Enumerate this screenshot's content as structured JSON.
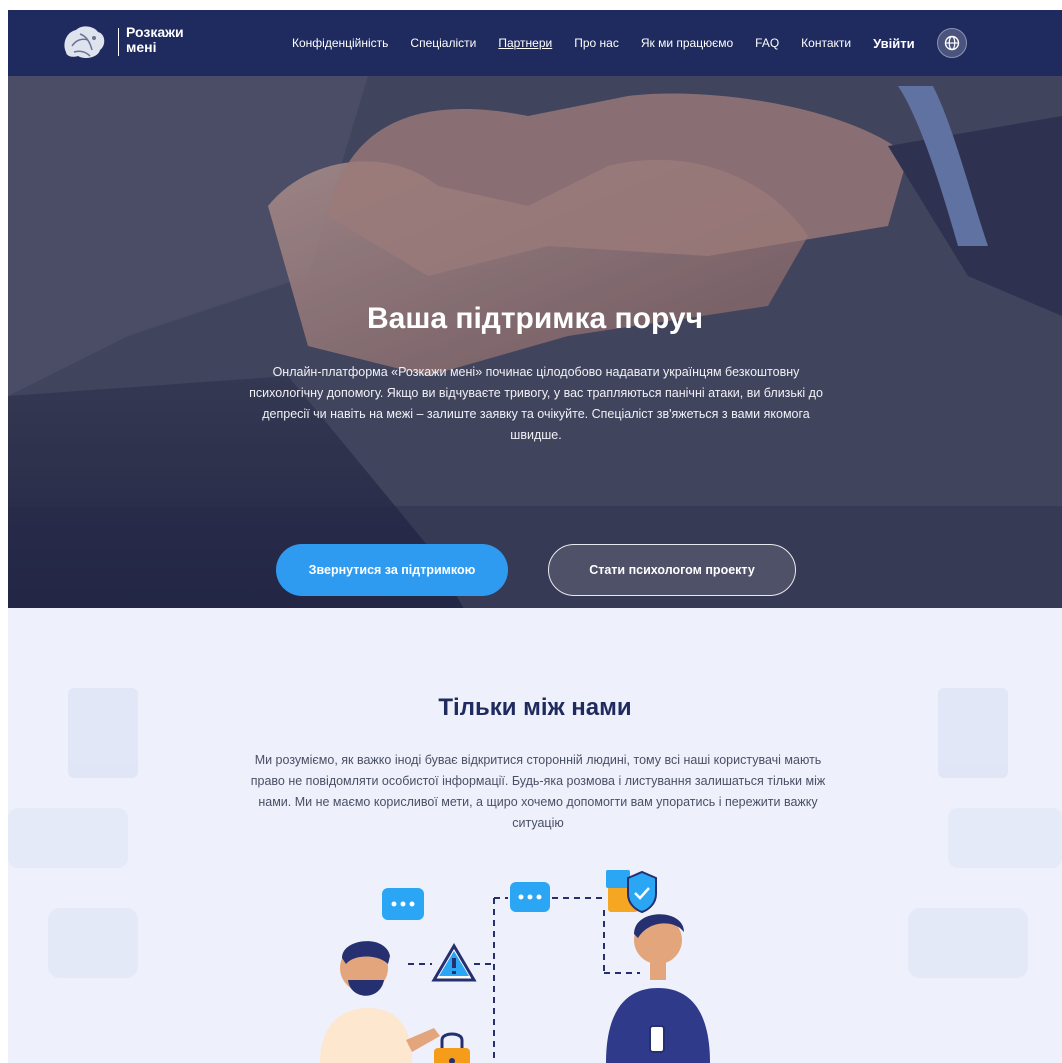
{
  "brand": {
    "name_line1": "Розкажи",
    "name_line2": "мені"
  },
  "nav": {
    "links": [
      {
        "label": "Конфіденційність"
      },
      {
        "label": "Спеціалісти"
      },
      {
        "label": "Партнери"
      },
      {
        "label": "Про нас"
      },
      {
        "label": "Як ми працюємо"
      },
      {
        "label": "FAQ"
      },
      {
        "label": "Контакти"
      }
    ],
    "active_link": "Партнери",
    "login_label": "Увійти",
    "language_icon": "globe-icon"
  },
  "hero": {
    "title": "Ваша підтримка поруч",
    "description": "Онлайн-платформа «Розкажи мені» починає цілодобово надавати українцям безкоштовну психологічну допомогу. Якщо ви відчуваєте тривогу, у вас трапляються панічні атаки, ви близькі до депресії чи навіть на межі – залиште заявку та очікуйте. Спеціаліст зв'яжеться з вами якомога швидше.",
    "primary_button": "Звернутися за підтримкою",
    "secondary_button": "Стати психологом проекту"
  },
  "privacy": {
    "title": "Тільки між нами",
    "description": "Ми розуміємо, як важко іноді буває відкритися сторонній людині, тому всі наші користувачі мають право не повідомляти особистої інформації. Будь-яка розмова і листування залишаться тільки між нами. Ми не маємо корисливої мети, а щиро хочемо допомогти вам упоратись і пережити важку ситуацію"
  },
  "colors": {
    "nav_bg": "#1f2a5e",
    "primary": "#2f9bf0",
    "section_bg": "#eef1fb",
    "heading": "#1f2a5e"
  }
}
